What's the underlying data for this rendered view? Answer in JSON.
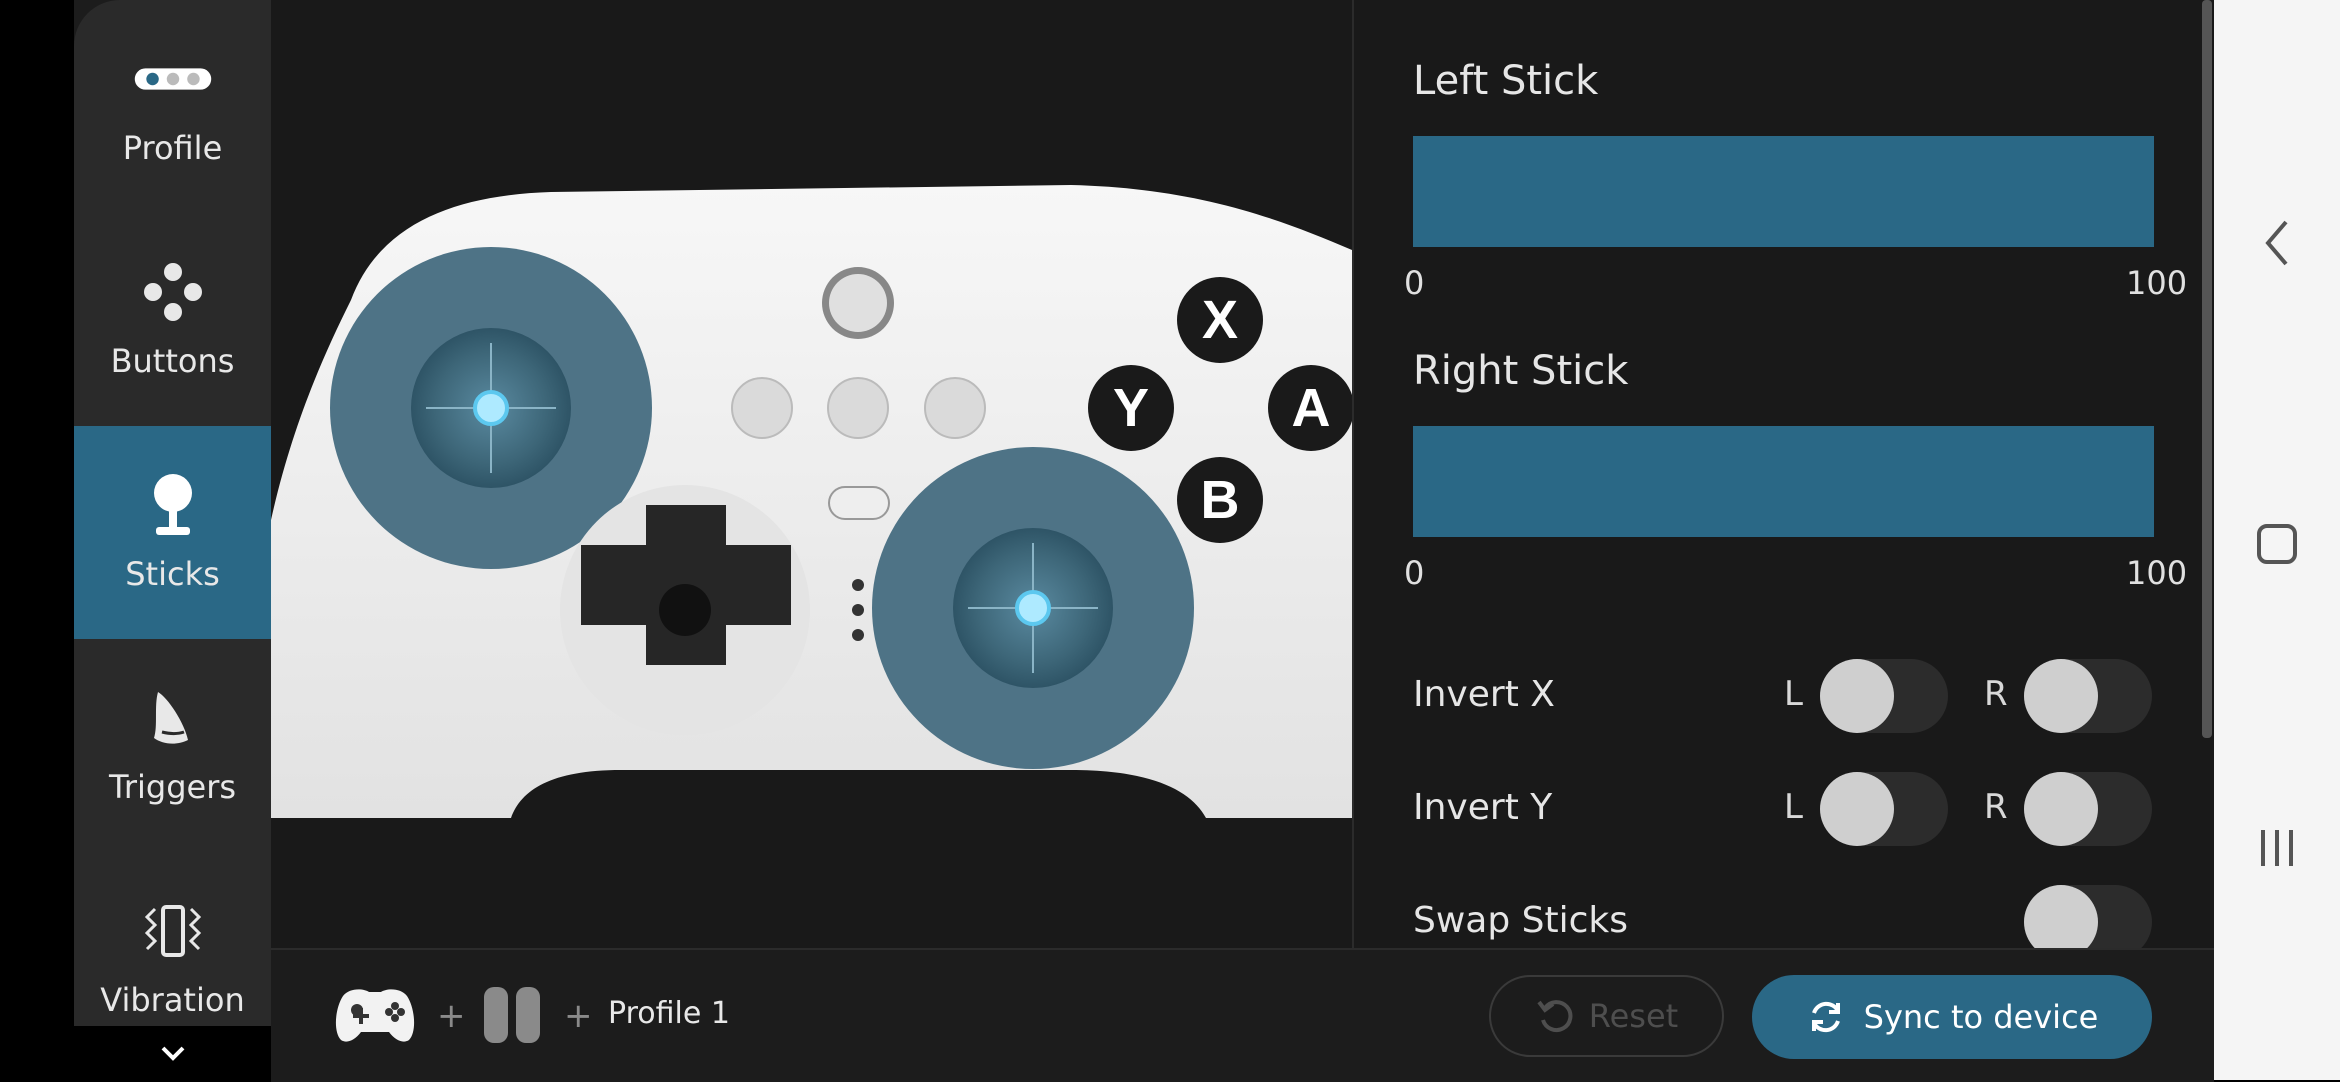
{
  "sidebar": {
    "items": [
      {
        "label": "Profile",
        "icon": "profile-dots-icon"
      },
      {
        "label": "Buttons",
        "icon": "buttons-icon"
      },
      {
        "label": "Sticks",
        "icon": "joystick-icon",
        "active": true
      },
      {
        "label": "Triggers",
        "icon": "trigger-icon"
      },
      {
        "label": "Vibration",
        "icon": "vibration-icon"
      }
    ],
    "more_icon": "chevron-down-icon"
  },
  "controller": {
    "buttons": {
      "x": "X",
      "y": "Y",
      "a": "A",
      "b": "B"
    }
  },
  "settings": {
    "left_stick": {
      "title": "Left Stick",
      "min": "0",
      "max": "100"
    },
    "right_stick": {
      "title": "Right Stick",
      "min": "0",
      "max": "100"
    },
    "invert_x": {
      "label": "Invert X",
      "l": "L",
      "r": "R",
      "l_on": false,
      "r_on": false
    },
    "invert_y": {
      "label": "Invert Y",
      "l": "L",
      "r": "R",
      "l_on": false,
      "r_on": false
    },
    "swap_sticks": {
      "label": "Swap Sticks",
      "on": false
    }
  },
  "bottom": {
    "plus1": "+",
    "plus2": "+",
    "profile": "Profile 1",
    "reset_label": "Reset",
    "sync_label": "Sync to device"
  },
  "colors": {
    "accent": "#2a6886",
    "sidebar": "#2a2a2a",
    "background": "#191919"
  }
}
